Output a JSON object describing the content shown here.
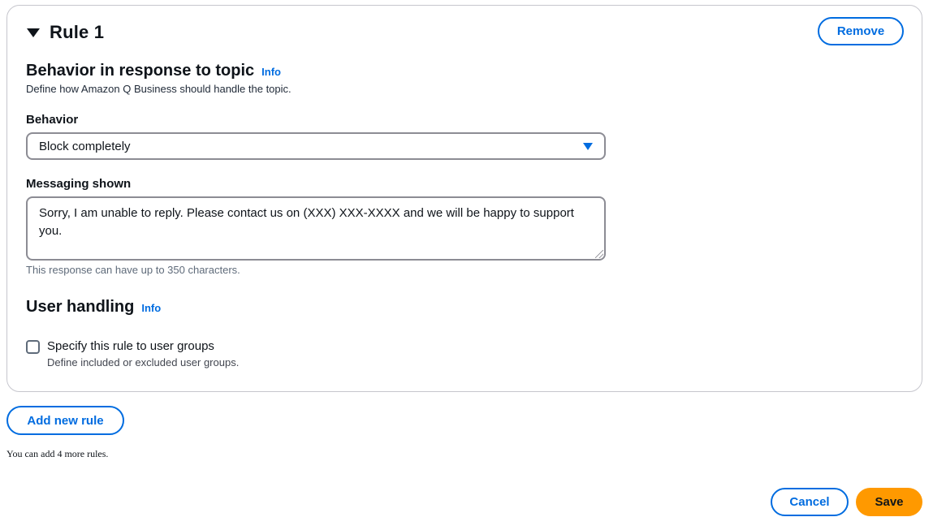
{
  "rule": {
    "title": "Rule 1",
    "remove_label": "Remove",
    "behavior_section": {
      "title": "Behavior in response to topic",
      "info_label": "Info",
      "description": "Define how Amazon Q Business should handle the topic."
    },
    "behavior_field": {
      "label": "Behavior",
      "selected_value": "Block completely"
    },
    "messaging_field": {
      "label": "Messaging shown",
      "value": "Sorry, I am unable to reply. Please contact us on (XXX) XXX-XXXX and we will be happy to support you.",
      "hint": "This response can have up to 350 characters."
    },
    "user_handling": {
      "title": "User handling",
      "info_label": "Info",
      "checkbox_label": "Specify this rule to user groups",
      "checkbox_description": "Define included or excluded user groups.",
      "checked": false
    }
  },
  "add_rule_label": "Add new rule",
  "rules_note": "You can add 4 more rules.",
  "footer": {
    "cancel_label": "Cancel",
    "save_label": "Save"
  },
  "colors": {
    "accent": "#006ce0",
    "primary_button": "#ff9900",
    "border": "#c6c6cd"
  }
}
